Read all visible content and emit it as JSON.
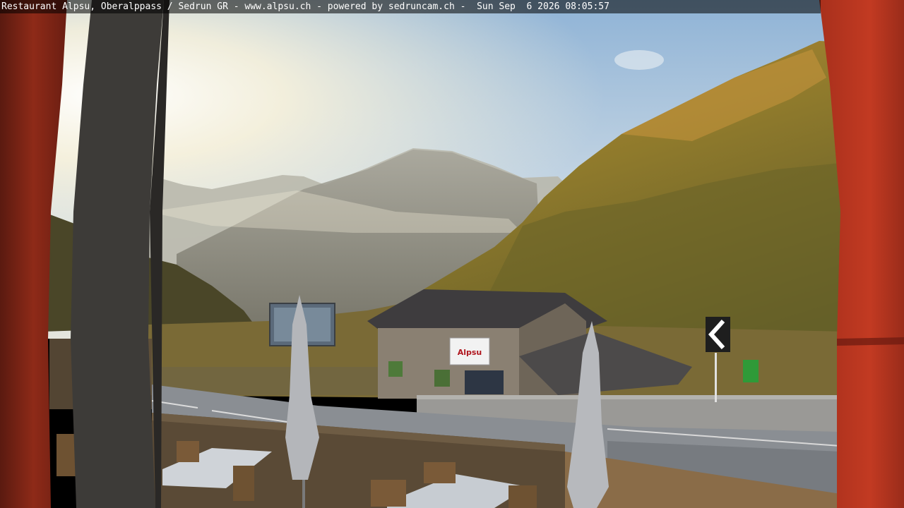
{
  "webcam": {
    "overlay_text": "Restaurant Alpsu, Oberalppass / Sedrun GR - www.alpsu.ch - powered by sedruncam.ch -  Sun Sep  6 2026 08:05:57"
  },
  "building": {
    "sign_text": "Alpsu"
  },
  "colors": {
    "sky_top": "#9fbfdc",
    "sky_glow": "#fff6da",
    "slope_lit": "#b08a2a",
    "slope_shade": "#5f5a28",
    "frame_red": "#8e2a18",
    "road": "#8a8e93",
    "overlay_bg": "#000000"
  }
}
